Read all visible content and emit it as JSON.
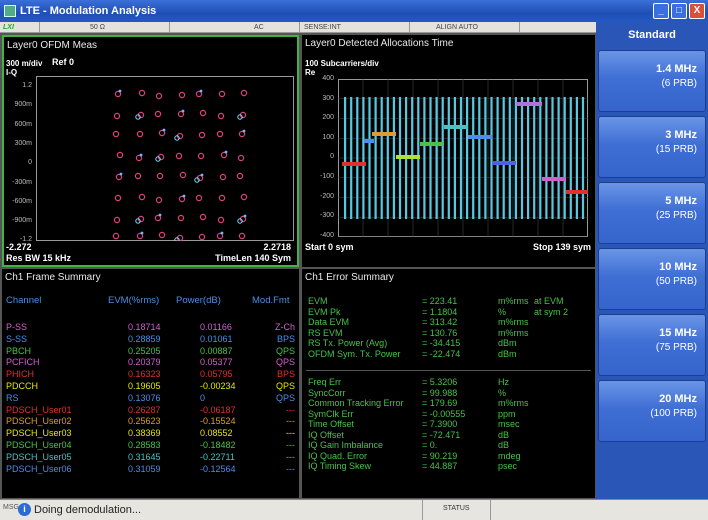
{
  "window": {
    "title": "LTE - Modulation Analysis",
    "buttons": [
      "_",
      "□",
      "X"
    ]
  },
  "status_strip": {
    "lxi": "LXI",
    "impedance": "50 Ω",
    "coupling": "AC",
    "sense": "SENSE:INT",
    "align": "ALIGN AUTO"
  },
  "constellation": {
    "title": "Layer0 OFDM Meas",
    "scale": "300 m/div",
    "ref": "Ref 0",
    "mode": "I-Q",
    "y_ticks": [
      "1.2",
      "900m",
      "600m",
      "300m",
      "0",
      "-300m",
      "-600m",
      "-900m",
      "-1.2"
    ],
    "x_start": "-2.272",
    "x_stop": "2.2718",
    "res_bw": "Res BW 15 kHz",
    "time_len": "TimeLen 140  Sym"
  },
  "alloc": {
    "title": "Layer0 Detected Allocations Time",
    "scale": "100  Subcarriers/div",
    "mode": "Re",
    "y_ticks": [
      "400",
      "300",
      "200",
      "100",
      "0",
      "-100",
      "-200",
      "-300",
      "-400"
    ],
    "start": "Start 0  sym",
    "stop": "Stop 139  sym"
  },
  "frame_summary": {
    "title": "Ch1 Frame Summary",
    "headers": [
      "Channel",
      "EVM(%rms)",
      "Power(dB)",
      "Mod.Fmt"
    ],
    "rows": [
      {
        "ch": "P-SS",
        "evm": "0.18714",
        "pwr": "0.01166",
        "mod": "Z-Ch",
        "color": "#d060d0"
      },
      {
        "ch": "S-SS",
        "evm": "0.28859",
        "pwr": "0.01061",
        "mod": "BPS",
        "color": "#4b8fe6"
      },
      {
        "ch": "PBCH",
        "evm": "0.25205",
        "pwr": "0.00887",
        "mod": "QPS",
        "color": "#48c24a"
      },
      {
        "ch": "PCFICH",
        "evm": "0.20379",
        "pwr": "0.05377",
        "mod": "QPS",
        "color": "#d060d0"
      },
      {
        "ch": "PHICH",
        "evm": "0.16323",
        "pwr": "0.05795",
        "mod": "BPS",
        "color": "#e03030"
      },
      {
        "ch": "PDCCH",
        "evm": "0.19605",
        "pwr": "-0.00234",
        "mod": "QPS",
        "color": "#e6e600"
      },
      {
        "ch": "RS",
        "evm": "0.13076",
        "pwr": "0",
        "mod": "QPS",
        "color": "#4b8fe6"
      },
      {
        "ch": "PDSCH_User01",
        "evm": "0.26287",
        "pwr": "-0.06187",
        "mod": "---",
        "color": "#e03030"
      },
      {
        "ch": "PDSCH_User02",
        "evm": "0.25623",
        "pwr": "-0.15524",
        "mod": "---",
        "color": "#e09a30"
      },
      {
        "ch": "PDSCH_User03",
        "evm": "0.38369",
        "pwr": "0.08552",
        "mod": "---",
        "color": "#e6e600"
      },
      {
        "ch": "PDSCH_User04",
        "evm": "0.28583",
        "pwr": "-0.18482",
        "mod": "---",
        "color": "#48c24a"
      },
      {
        "ch": "PDSCH_User05",
        "evm": "0.31645",
        "pwr": "-0.22711",
        "mod": "---",
        "color": "#48c2c2"
      },
      {
        "ch": "PDSCH_User06",
        "evm": "0.31059",
        "pwr": "-0.12564",
        "mod": "---",
        "color": "#4b8fe6"
      }
    ]
  },
  "error_summary": {
    "title": "Ch1 Error Summary",
    "group1": [
      {
        "label": "EVM",
        "value": "= 223.41",
        "unit": "m%rms",
        "extra": "at   EVM"
      },
      {
        "label": "EVM Pk",
        "value": "= 1.1804",
        "unit": "%",
        "extra": "at   sym 2"
      },
      {
        "label": "Data EVM",
        "value": "= 313.42",
        "unit": "m%rms",
        "extra": ""
      },
      {
        "label": "RS EVM",
        "value": "= 130.76",
        "unit": "m%rms",
        "extra": ""
      },
      {
        "label": "RS Tx. Power (Avg)",
        "value": "= -34.415",
        "unit": "dBm",
        "extra": ""
      },
      {
        "label": "OFDM Sym. Tx. Power",
        "value": "= -22.474",
        "unit": "dBm",
        "extra": ""
      }
    ],
    "group2": [
      {
        "label": "Freq Err",
        "value": "= 5.3206",
        "unit": "Hz"
      },
      {
        "label": "SyncCorr",
        "value": "= 99.988",
        "unit": "%"
      },
      {
        "label": "Common Tracking Error",
        "value": "= 179.69",
        "unit": "m%rms"
      },
      {
        "label": "SymClk Err",
        "value": "= -0.00555",
        "unit": "ppm"
      },
      {
        "label": "Time Offset",
        "value": "= 7.3900",
        "unit": "msec"
      },
      {
        "label": "IQ Offset",
        "value": "= -72.471",
        "unit": "dB"
      },
      {
        "label": "IQ Gain Imbalance",
        "value": "= 0.",
        "unit": "dB"
      },
      {
        "label": "IQ Quad. Error",
        "value": "= 90.219",
        "unit": "mdeg"
      },
      {
        "label": "IQ Timing Skew",
        "value": "= 44.887",
        "unit": "psec"
      }
    ]
  },
  "softkeys": {
    "header": "Standard",
    "buttons": [
      {
        "l1": "1.4 MHz",
        "l2": "(6 PRB)"
      },
      {
        "l1": "3 MHz",
        "l2": "(15 PRB)"
      },
      {
        "l1": "5 MHz",
        "l2": "(25 PRB)"
      },
      {
        "l1": "10 MHz",
        "l2": "(50 PRB)"
      },
      {
        "l1": "15 MHz",
        "l2": "(75 PRB)"
      },
      {
        "l1": "20 MHz",
        "l2": "(100 PRB)"
      }
    ]
  },
  "bottom": {
    "msg": "MSG",
    "text": "Doing demodulation...",
    "status": "STATUS"
  }
}
